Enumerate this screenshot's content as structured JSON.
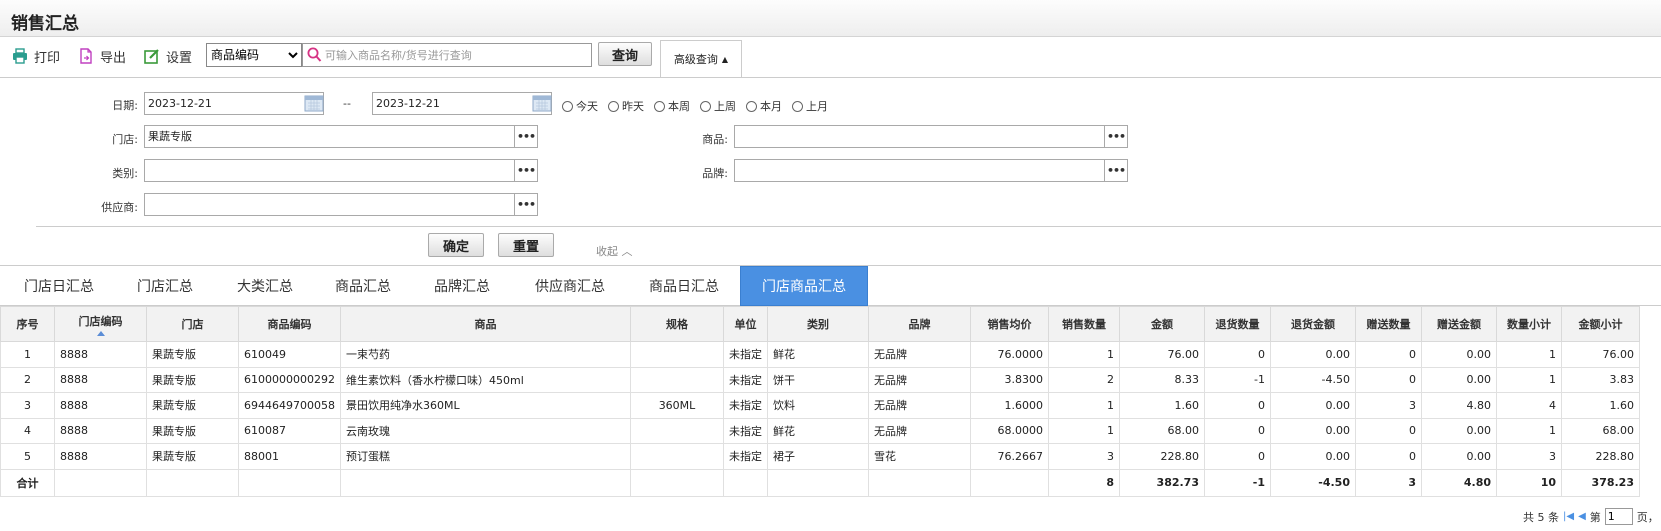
{
  "page": {
    "title": "销售汇总"
  },
  "toolbar": {
    "print_label": "打印",
    "export_label": "导出",
    "settings_label": "设置",
    "field_select": {
      "value": "商品编码"
    },
    "search": {
      "placeholder": "可输入商品名称/货号进行查询"
    },
    "query_label": "查询",
    "advanced_label": "高级查询"
  },
  "filters": {
    "date_label": "日期:",
    "date_from": "2023-12-21",
    "date_sep": "--",
    "date_to": "2023-12-21",
    "quick_ranges": [
      "今天",
      "昨天",
      "本周",
      "上周",
      "本月",
      "上月"
    ],
    "store_label": "门店:",
    "store_value": "果蔬专版",
    "product_label": "商品:",
    "product_value": "",
    "category_label": "类别:",
    "category_value": "",
    "brand_label": "品牌:",
    "brand_value": "",
    "supplier_label": "供应商:",
    "supplier_value": "",
    "dots": "•••",
    "confirm_label": "确定",
    "reset_label": "重置",
    "collapse_label": "收起"
  },
  "tabs": [
    "门店日汇总",
    "门店汇总",
    "大类汇总",
    "商品汇总",
    "品牌汇总",
    "供应商汇总",
    "商品日汇总",
    "门店商品汇总"
  ],
  "active_tab": "门店商品汇总",
  "table": {
    "columns": [
      "序号",
      "门店编码",
      "门店",
      "商品编码",
      "商品",
      "规格",
      "单位",
      "类别",
      "品牌",
      "销售均价",
      "销售数量",
      "金额",
      "退货数量",
      "退货金额",
      "赠送数量",
      "赠送金额",
      "数量小计",
      "金额小计"
    ],
    "rows": [
      [
        "1",
        "8888",
        "果蔬专版",
        "610049",
        "一束芍药",
        "",
        "未指定",
        "鲜花",
        "无品牌",
        "76.0000",
        "1",
        "76.00",
        "0",
        "0.00",
        "0",
        "0.00",
        "1",
        "76.00"
      ],
      [
        "2",
        "8888",
        "果蔬专版",
        "6100000000292",
        "维生素饮料（香水柠檬口味）450ml",
        "",
        "未指定",
        "饼干",
        "无品牌",
        "3.8300",
        "2",
        "8.33",
        "-1",
        "-4.50",
        "0",
        "0.00",
        "1",
        "3.83"
      ],
      [
        "3",
        "8888",
        "果蔬专版",
        "6944649700058",
        "景田饮用纯净水360ML",
        "360ML",
        "未指定",
        "饮料",
        "无品牌",
        "1.6000",
        "1",
        "1.60",
        "0",
        "0.00",
        "3",
        "4.80",
        "4",
        "1.60"
      ],
      [
        "4",
        "8888",
        "果蔬专版",
        "610087",
        "云南玫瑰",
        "",
        "未指定",
        "鲜花",
        "无品牌",
        "68.0000",
        "1",
        "68.00",
        "0",
        "0.00",
        "0",
        "0.00",
        "1",
        "68.00"
      ],
      [
        "5",
        "8888",
        "果蔬专版",
        "88001",
        "预订蛋糕",
        "",
        "未指定",
        "裙子",
        "雪花",
        "76.2667",
        "3",
        "228.80",
        "0",
        "0.00",
        "0",
        "0.00",
        "3",
        "228.80"
      ]
    ],
    "summary": [
      "合计",
      "",
      "",
      "",
      "",
      "",
      "",
      "",
      "",
      "",
      "8",
      "382.73",
      "-1",
      "-4.50",
      "3",
      "4.80",
      "10",
      "378.23"
    ]
  },
  "pager": {
    "total": "共 5 条",
    "page_prefix": "第",
    "page_value": "1",
    "page_suffix": "页，"
  },
  "colors": {
    "accent": "#4a90e2",
    "icon_teal": "#2a9d8f",
    "icon_green": "#3a9a3a",
    "icon_magenta": "#c040c0"
  }
}
